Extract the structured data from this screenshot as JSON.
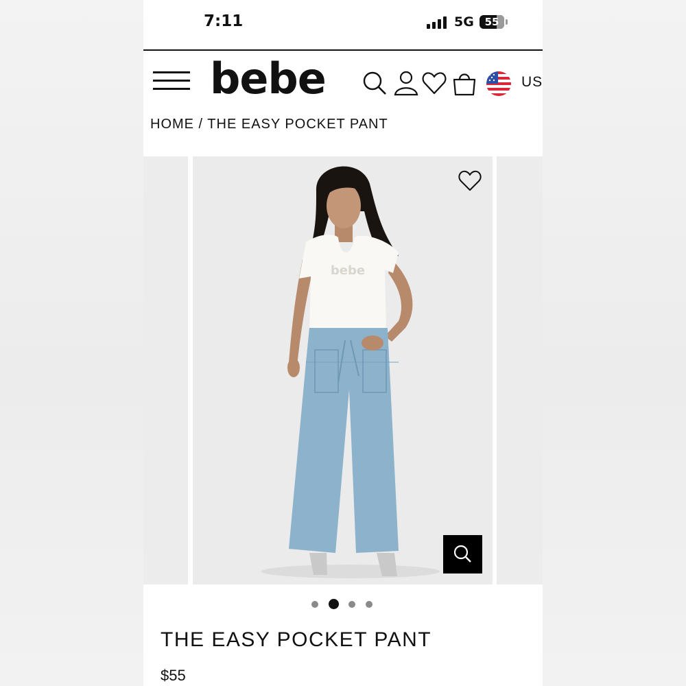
{
  "status_bar": {
    "time": "7:11",
    "network": "5G",
    "battery": "55",
    "battery_level": 0.55
  },
  "header": {
    "logo": "bebe",
    "menu_icon": "hamburger-menu-icon",
    "icons": [
      "search-icon",
      "account-icon",
      "wishlist-heart-icon",
      "shopping-bag-icon"
    ],
    "flag_icon": "us-flag-icon",
    "country": "US"
  },
  "breadcrumb": {
    "text": "HOME / THE EASY POCKET PANT"
  },
  "gallery": {
    "favorite_icon": "heart-outline-icon",
    "zoom_icon": "magnifier-icon",
    "dot_count": 4,
    "active_index": 1,
    "shirt_print": "bebe"
  },
  "product": {
    "title": "THE EASY POCKET PANT",
    "price": "$55"
  },
  "colors": {
    "text": "#111111",
    "denim": "#8db3cc",
    "page_bg": "#ebebeb"
  }
}
